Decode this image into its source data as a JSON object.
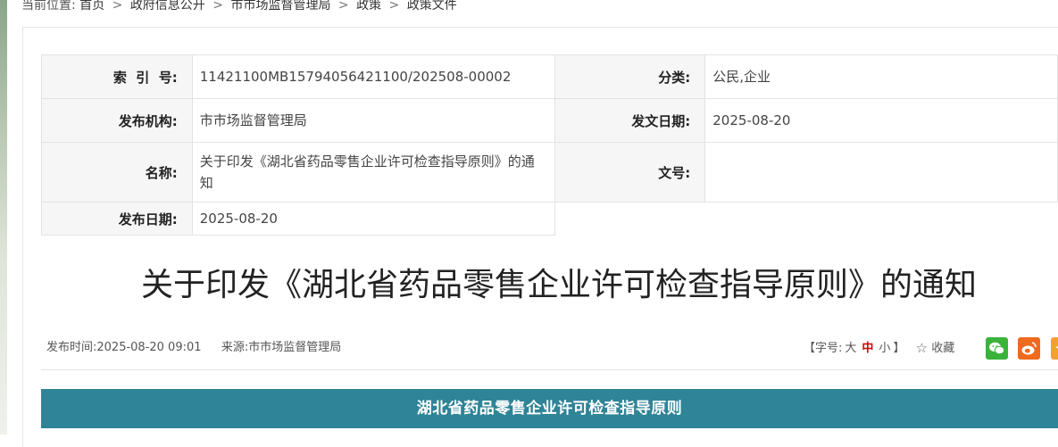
{
  "breadcrumb": {
    "prefix": "当前位置:",
    "items": [
      "首页",
      "政府信息公开",
      "市市场监督管理局",
      "政策",
      "政策文件"
    ],
    "separator": ">"
  },
  "meta": {
    "index_label": "索  引  号:",
    "index_value": "11421100MB15794056421100/202508-00002",
    "category_label": "分类:",
    "category_value": "公民,企业",
    "issuer_label": "发布机构:",
    "issuer_value": "市市场监督管理局",
    "doc_date_label": "发文日期:",
    "doc_date_value": "2025-08-20",
    "name_label": "名称:",
    "name_value": "关于印发《湖北省药品零售企业许可检查指导原则》的通知",
    "doc_no_label": "文号:",
    "doc_no_value": "",
    "pub_date_label": "发布日期:",
    "pub_date_value": "2025-08-20"
  },
  "article": {
    "title": "关于印发《湖北省药品零售企业许可检查指导原则》的通知",
    "publish_time": "发布时间:2025-08-20 09:01",
    "source": "来源:市市场监督管理局",
    "font_size_prefix": "【字号:",
    "font_sizes": [
      "大",
      "中",
      "小"
    ],
    "font_size_suffix": "】",
    "favorite_label": "收藏",
    "banner": "湖北省药品零售企业许可检查指导原则"
  },
  "share": {
    "icons": [
      "wechat-icon",
      "weibo-icon",
      "qzone-icon"
    ]
  },
  "colors": {
    "banner": "#2f8497",
    "font_active": "#cc0000",
    "wechat": "#3bb33b",
    "weibo": "#f06a1e"
  }
}
